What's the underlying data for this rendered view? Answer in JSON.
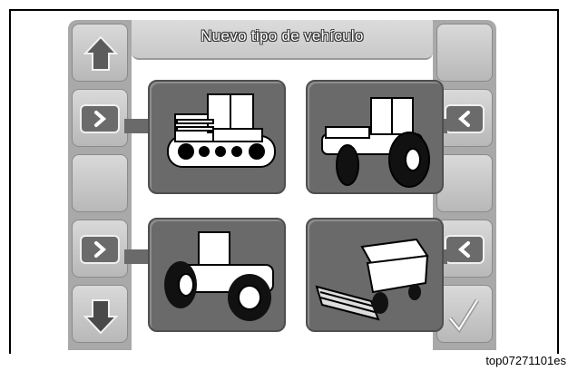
{
  "screen": {
    "title": "Nuevo tipo de vehículo"
  },
  "left_buttons": [
    {
      "icon": "arrow-up-icon"
    },
    {
      "icon": "chevron-right-icon"
    },
    {
      "icon": "blank"
    },
    {
      "icon": "chevron-right-icon"
    },
    {
      "icon": "arrow-down-icon"
    }
  ],
  "right_buttons": [
    {
      "icon": "blank"
    },
    {
      "icon": "chevron-left-icon"
    },
    {
      "icon": "blank"
    },
    {
      "icon": "chevron-left-icon"
    },
    {
      "icon": "checkmark-icon"
    }
  ],
  "vehicles": [
    {
      "icon": "tracked-tractor-icon"
    },
    {
      "icon": "wheeled-tractor-icon"
    },
    {
      "icon": "articulated-tractor-icon"
    },
    {
      "icon": "combine-harvester-icon"
    }
  ],
  "figure_id": "top07271101es"
}
